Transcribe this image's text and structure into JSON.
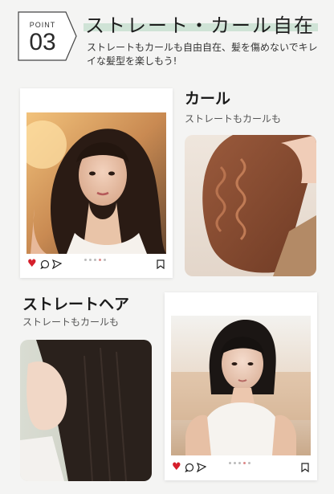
{
  "header": {
    "point_label": "POINT",
    "point_number": "03",
    "title": "ストレート・カール自在",
    "description": "ストレートもカールも自由自在、髪を傷めないでキレイな髪型を楽しもう!"
  },
  "sections": {
    "curl": {
      "title": "カール",
      "subtitle": "ストレートもカールも"
    },
    "straight": {
      "title": "ストレートヘア",
      "subtitle": "ストレートもカールも"
    }
  },
  "icons": {
    "like": "heart-icon",
    "comment": "comment-icon",
    "share": "send-icon",
    "save": "bookmark-icon"
  },
  "colors": {
    "background": "#f4f4f3",
    "heart": "#d51f2b",
    "title_highlight": "#cfe3d6"
  }
}
